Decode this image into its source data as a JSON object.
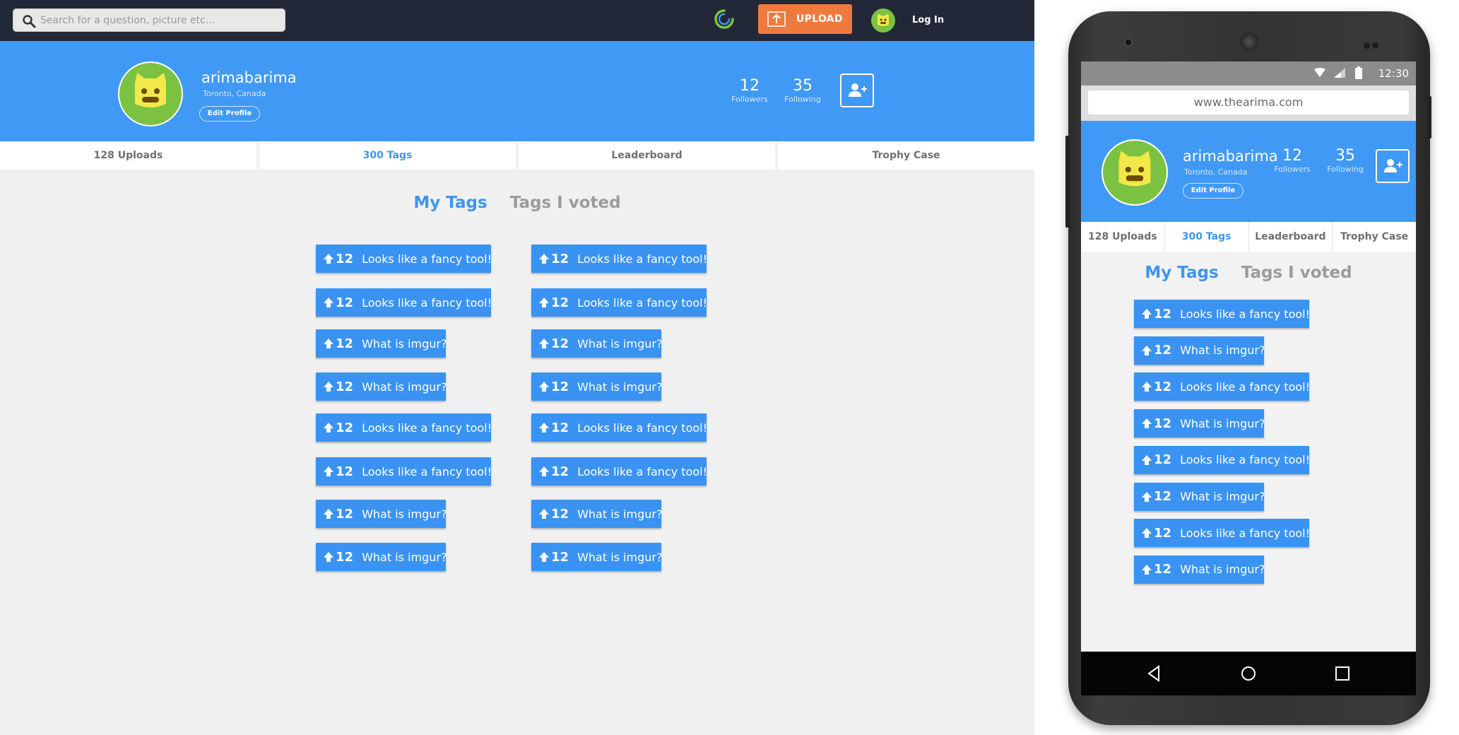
{
  "colors": {
    "accent": "#3f95ef",
    "profile_band": "#4099f5",
    "topbar": "#222838",
    "upload": "#f07a3e",
    "tag": "#3a93f2"
  },
  "header": {
    "search_placeholder": "Search for a question, picture etc…",
    "upload_label": "UPLOAD",
    "login_label": "Log In"
  },
  "profile": {
    "username": "arimabarima",
    "location": "Toronto, Canada",
    "edit_label": "Edit Profile",
    "followers_count": "12",
    "followers_label": "Followers",
    "following_count": "35",
    "following_label": "Following"
  },
  "tabs": [
    {
      "label": "128 Uploads"
    },
    {
      "label": "300 Tags"
    },
    {
      "label": "Leaderboard"
    },
    {
      "label": "Trophy Case"
    }
  ],
  "subtabs": {
    "my_tags": "My Tags",
    "tags_voted": "Tags I voted"
  },
  "tags_left": [
    {
      "count": "12",
      "text": "Looks like a fancy tool!"
    },
    {
      "count": "12",
      "text": "Looks like a fancy tool!"
    },
    {
      "count": "12",
      "text": "What is imgur?"
    },
    {
      "count": "12",
      "text": "What is imgur?"
    },
    {
      "count": "12",
      "text": "Looks like a fancy tool!"
    },
    {
      "count": "12",
      "text": "Looks like a fancy tool!"
    },
    {
      "count": "12",
      "text": "What is imgur?"
    },
    {
      "count": "12",
      "text": "What is imgur?"
    }
  ],
  "tags_right": [
    {
      "count": "12",
      "text": "Looks like a fancy tool!"
    },
    {
      "count": "12",
      "text": "Looks like a fancy tool!"
    },
    {
      "count": "12",
      "text": "What is imgur?"
    },
    {
      "count": "12",
      "text": "What is imgur?"
    },
    {
      "count": "12",
      "text": "Looks like a fancy tool!"
    },
    {
      "count": "12",
      "text": "Looks like a fancy tool!"
    },
    {
      "count": "12",
      "text": "What is imgur?"
    },
    {
      "count": "12",
      "text": "What is imgur?"
    }
  ],
  "mobile": {
    "time": "12:30",
    "url": "www.thearima.com",
    "tags": [
      {
        "count": "12",
        "text": "Looks like a fancy tool!"
      },
      {
        "count": "12",
        "text": "What is imgur?"
      },
      {
        "count": "12",
        "text": "Looks like a fancy tool!"
      },
      {
        "count": "12",
        "text": "What is imgur?"
      },
      {
        "count": "12",
        "text": "Looks like a fancy tool!"
      },
      {
        "count": "12",
        "text": "What is imgur?"
      },
      {
        "count": "12",
        "text": "Looks like a fancy tool!"
      },
      {
        "count": "12",
        "text": "What is imgur?"
      }
    ]
  }
}
